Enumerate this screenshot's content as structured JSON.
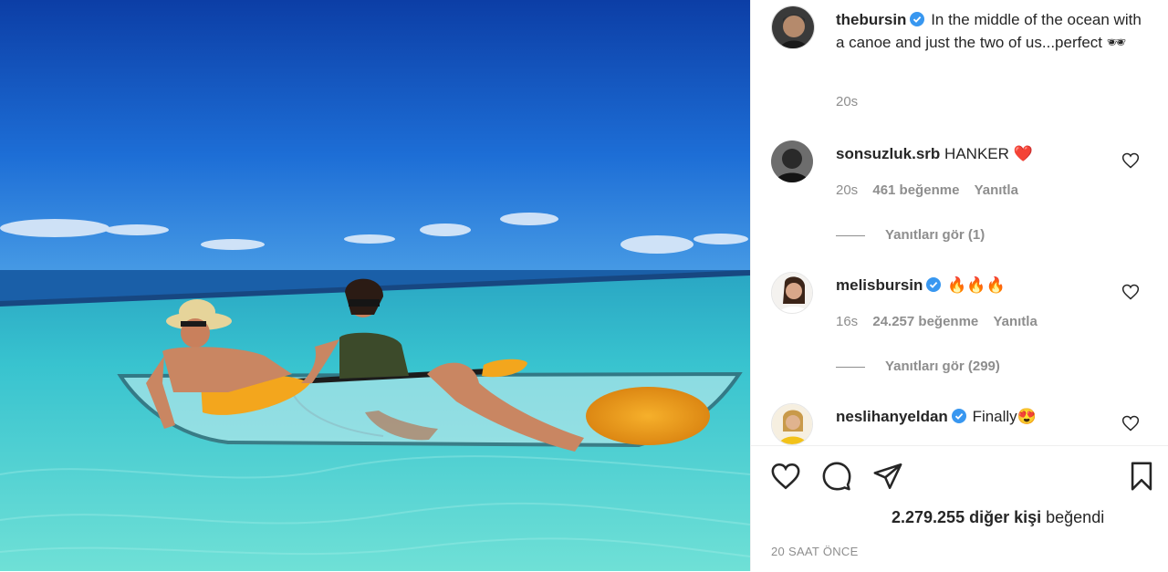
{
  "post": {
    "author": "thebursin",
    "caption": "In the middle of the ocean with a canoe and just the two of us...perfect 🕶",
    "time": "20s"
  },
  "comments": [
    {
      "user": "sonsuzluk.srb",
      "text": "HANKER ❤️",
      "time": "20s",
      "likes": "461 beğenme",
      "reply": "Yanıtla",
      "view_replies": "Yanıtları gör (1)",
      "verified": false
    },
    {
      "user": "melisbursin",
      "text": "🔥🔥🔥",
      "time": "16s",
      "likes": "24.257 beğenme",
      "reply": "Yanıtla",
      "view_replies": "Yanıtları gör (299)",
      "verified": true
    },
    {
      "user": "neslihanyeldan",
      "text": "Finally😍",
      "verified": true
    }
  ],
  "footer": {
    "likes_count": "2.279.255",
    "likes_suffix": "diğer kişi",
    "likes_verb": "beğendi",
    "timestamp": "20 SAAT ÖNCE"
  },
  "colors": {
    "verified": "#3897f0",
    "text": "#262626",
    "muted": "#8e8e8e",
    "sky": "#1f4fb0",
    "sea": "#3fc3cf"
  },
  "icons": [
    "verified-badge-icon",
    "heart-icon",
    "comment-icon",
    "share-icon",
    "bookmark-icon"
  ]
}
